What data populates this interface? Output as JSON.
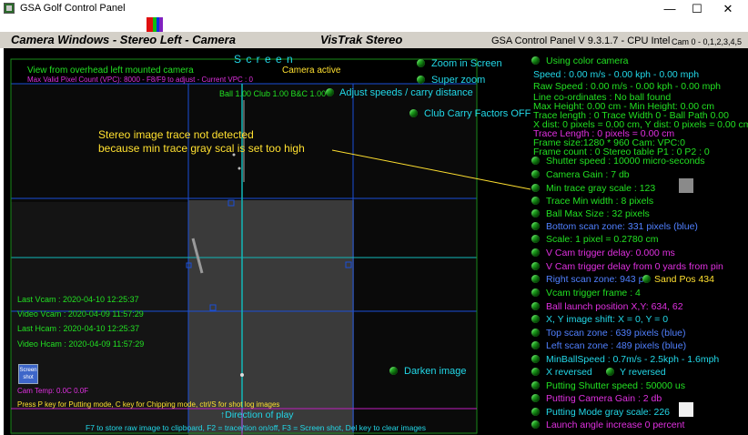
{
  "window": {
    "title": "GSA Golf Control Panel",
    "minimize": "—",
    "maximize": "☐",
    "close": "✕"
  },
  "header": {
    "left_title": "Camera Windows - Stereo Left - Camera",
    "center_title": "VisTrak Stereo",
    "version": "GSA Control Panel  V 9.3.1.7 - CPU Intel",
    "cam_ids": "Cam 0 - 0,1,2,3,4,5"
  },
  "screen": {
    "label": "S c r e e n",
    "camera_active": "Camera active",
    "view_desc": "View from overhead left mounted camera",
    "max_pixel": "Max Valid Pixel Count (VPC): 8000  - F8/F9 to adjust - Current VPC : 0",
    "ball_club": "Ball 1.00 Club 1.00 B&C 1.00",
    "zoom_in": "Zoom in Screen",
    "super_zoom": "Super zoom",
    "adjust_speeds": "Adjust speeds / carry distance",
    "club_carry": "Club Carry Factors OFF",
    "note_line1": "Stereo image trace not detected",
    "note_line2": "because min trace gray scal is set too high",
    "last_vcam": "Last Vcam : 2020-04-10 12:25:37",
    "video_vcam": "Video Vcam : 2020-04-09 11:57:29",
    "last_hcam": "Last Hcam : 2020-04-10 12:25:37",
    "video_hcam": "Video Hcam : 2020-04-09 11:57:29",
    "screen_shot": "Screen shot",
    "cam_temp": "Cam Temp: 0.0C 0.0F",
    "darken": "Darken image",
    "press_p": "Press P key for Putting mode, C key for Chipping mode, ctrl/S for shot log images",
    "direction": "Direction of play",
    "f7_line": "F7 to store raw image to clipboard, F2 = trace/tion on/off, F3 = Screen shot, Del key to clear images"
  },
  "panel": {
    "using_color": "Using color camera",
    "speed": "Speed : 0.00 m/s - 0.00 kph - 0.00 mph",
    "raw_speed": "Raw Speed : 0.00 m/s - 0.00 kph - 0.00 mph",
    "line_coords": "Line co-ordinates : No ball found",
    "max_height": "Max Height: 0.00 cm - Min Height: 0.00 cm",
    "trace_len": "Trace length : 0 Trace Width 0 - Ball Path 0.00",
    "x_dist": "X dist: 0 pixels = 0.00 cm, Y dist: 0 pixels = 0.00 cm",
    "trace_len2": "Trace Length : 0 pixels = 0.00 cm",
    "frame_size": "Frame size:1280 * 960 Cam:  VPC:0",
    "frame_count": "Frame count : 0           Stereo table P1 : 0 P2 : 0",
    "shutter": "Shutter speed : 10000 micro-seconds",
    "gain": "Camera Gain : 7 db",
    "min_trace_gray": "Min trace gray scale : 123",
    "trace_min_width": "Trace Min width : 8 pixels",
    "ball_max": "Ball Max Size : 32 pixels",
    "bottom_scan": "Bottom scan zone: 331 pixels (blue)",
    "scale": "Scale: 1 pixel = 0.2780 cm",
    "vcam_delay": "V Cam trigger delay: 0.000 ms",
    "vcam_delay2": "V Cam trigger delay from 0 yards from pin",
    "right_scan": "Right scan zone: 943 px",
    "sand_pos": "Sand Pos 434",
    "vcam_frame": "Vcam trigger frame : 4",
    "ball_launch": "Ball launch position X,Y: 634, 62",
    "xy_shift": "X, Y image shift: X = 0, Y = 0",
    "top_scan": "Top scan zone : 639 pixels (blue)",
    "left_scan": "Left scan zone : 489 pixels (blue)",
    "min_ball_speed": "MinBallSpeed : 0.7m/s - 2.5kph - 1.6mph",
    "x_rev": "X reversed",
    "y_rev": "Y reversed",
    "putt_shutter": "Putting Shutter speed : 50000 us",
    "putt_gain": "Putting Camera Gain : 2 db",
    "putt_gray": "Putting Mode gray scale: 226",
    "launch_angle": "Launch angle increase 0 percent"
  },
  "colors": {
    "green_text": "#22e022",
    "cyan_text": "#22d8e8",
    "blue_text": "#5080ff",
    "magenta_text": "#e030e0",
    "yellow_text": "#ffe030",
    "grid_blue": "#1a4fd8",
    "grid_cyan": "#11b8b8"
  }
}
